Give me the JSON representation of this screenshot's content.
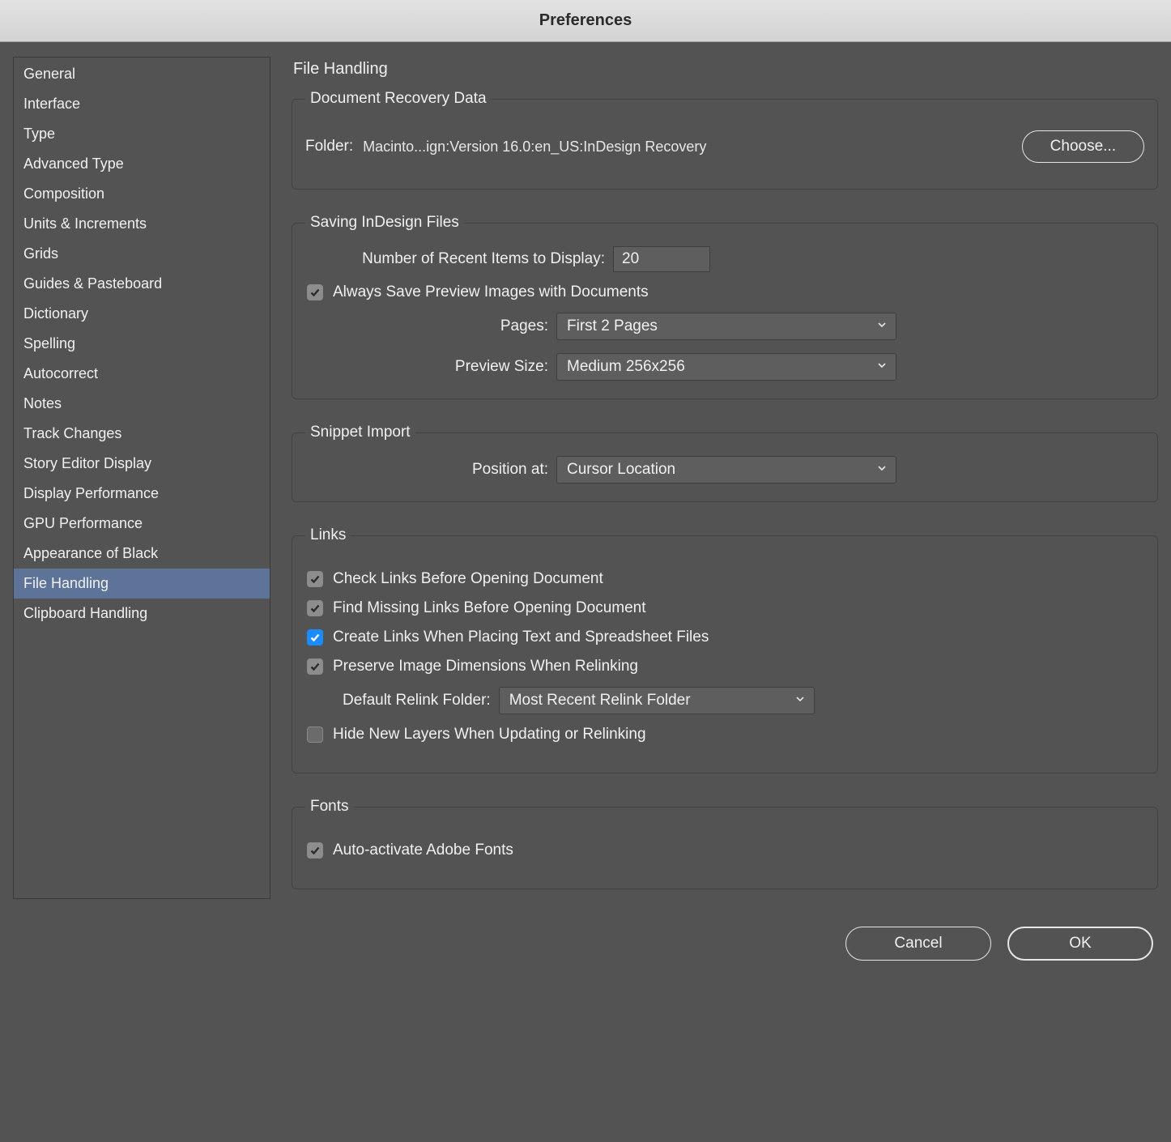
{
  "title": "Preferences",
  "sidebar": {
    "items": [
      "General",
      "Interface",
      "Type",
      "Advanced Type",
      "Composition",
      "Units & Increments",
      "Grids",
      "Guides & Pasteboard",
      "Dictionary",
      "Spelling",
      "Autocorrect",
      "Notes",
      "Track Changes",
      "Story Editor Display",
      "Display Performance",
      "GPU Performance",
      "Appearance of Black",
      "File Handling",
      "Clipboard Handling"
    ],
    "selected": "File Handling"
  },
  "panel": {
    "title": "File Handling",
    "recovery": {
      "legend": "Document Recovery Data",
      "folder_label": "Folder:",
      "folder_path": "Macinto...ign:Version 16.0:en_US:InDesign Recovery",
      "choose_label": "Choose..."
    },
    "saving": {
      "legend": "Saving InDesign Files",
      "recent_label": "Number of Recent Items to Display:",
      "recent_value": "20",
      "always_save_preview": "Always Save Preview Images with Documents",
      "pages_label": "Pages:",
      "pages_value": "First 2 Pages",
      "preview_size_label": "Preview Size:",
      "preview_size_value": "Medium 256x256"
    },
    "snippet": {
      "legend": "Snippet Import",
      "position_label": "Position at:",
      "position_value": "Cursor Location"
    },
    "links": {
      "legend": "Links",
      "check_links": "Check Links Before Opening Document",
      "find_missing": "Find Missing Links Before Opening Document",
      "create_links": "Create Links When Placing Text and Spreadsheet Files",
      "preserve_dims": "Preserve Image Dimensions When Relinking",
      "default_relink_label": "Default Relink Folder:",
      "default_relink_value": "Most Recent Relink Folder",
      "hide_new_layers": "Hide New Layers When Updating or Relinking"
    },
    "fonts": {
      "legend": "Fonts",
      "auto_activate": "Auto-activate Adobe Fonts"
    }
  },
  "footer": {
    "cancel": "Cancel",
    "ok": "OK"
  }
}
